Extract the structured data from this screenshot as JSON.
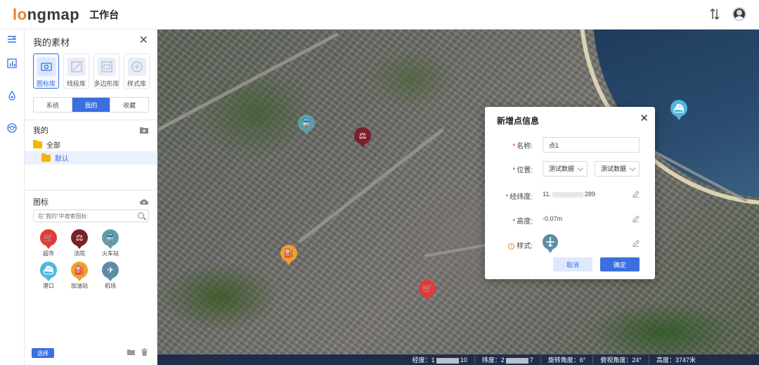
{
  "header": {
    "logo_part1": "lo",
    "logo_part2": "ngmap",
    "title": "工作台"
  },
  "panel": {
    "title": "我的素材",
    "tiles": [
      {
        "label": "图标库",
        "active": true
      },
      {
        "label": "线段库",
        "active": false
      },
      {
        "label": "多边形库",
        "active": false
      },
      {
        "label": "样式库",
        "active": false
      }
    ],
    "segments": [
      {
        "label": "系统",
        "active": false
      },
      {
        "label": "我的",
        "active": true
      },
      {
        "label": "收藏",
        "active": false
      }
    ],
    "my_section_title": "我的",
    "tree": [
      {
        "label": "全部",
        "selected": false
      },
      {
        "label": "默认",
        "selected": true
      }
    ],
    "icons_section_title": "图标",
    "search_placeholder": "在\"我的\"中搜索图标",
    "icons": [
      {
        "label": "超市",
        "glyph": "🛒",
        "color": "#e53935"
      },
      {
        "label": "法院",
        "glyph": "⚖",
        "color": "#7a1f2b"
      },
      {
        "label": "火车站",
        "glyph": "🚆",
        "color": "#5e9ea8"
      },
      {
        "label": "港口",
        "glyph": "⛴",
        "color": "#4fb6e0"
      },
      {
        "label": "加油站",
        "glyph": "⛽",
        "color": "#f0a030"
      },
      {
        "label": "机场",
        "glyph": "✈",
        "color": "#5e8ca8"
      }
    ],
    "select_button": "选择"
  },
  "status": {
    "longitude_label": "经度：1",
    "longitude_tail": "10",
    "latitude_label": "纬度：2",
    "latitude_tail": "7",
    "rotation": "旋转角度：6°",
    "pitch": "俯视角度：24°",
    "height": "高度：3747米"
  },
  "dialog": {
    "title": "新增点信息",
    "name_label": "名称:",
    "name_value": "点1",
    "position_label": "位置:",
    "position_select1": "测试数据",
    "position_select2": "测试数据",
    "lnglat_label": "经纬度:",
    "lnglat_head": "11.",
    "lnglat_tail": "289",
    "altitude_label": "高度:",
    "altitude_value": "-0.07m",
    "style_label": "样式:",
    "style_icon": "airport-icon",
    "cancel": "取消",
    "confirm": "确定"
  },
  "map_markers": [
    {
      "name": "train-station-marker",
      "glyph": "🚆",
      "color": "#5e9ea8"
    },
    {
      "name": "court-marker",
      "glyph": "⚖",
      "color": "#7a1f2b"
    },
    {
      "name": "port-marker",
      "glyph": "⛴",
      "color": "#4fb6e0"
    },
    {
      "name": "gas-station-marker",
      "glyph": "⛽",
      "color": "#f0a030"
    },
    {
      "name": "supermarket-marker",
      "glyph": "🛒",
      "color": "#e53935"
    }
  ],
  "colors": {
    "primary": "#3b6fe0",
    "logo_orange": "#e8812a",
    "status_bar": "#1f2d4a"
  }
}
